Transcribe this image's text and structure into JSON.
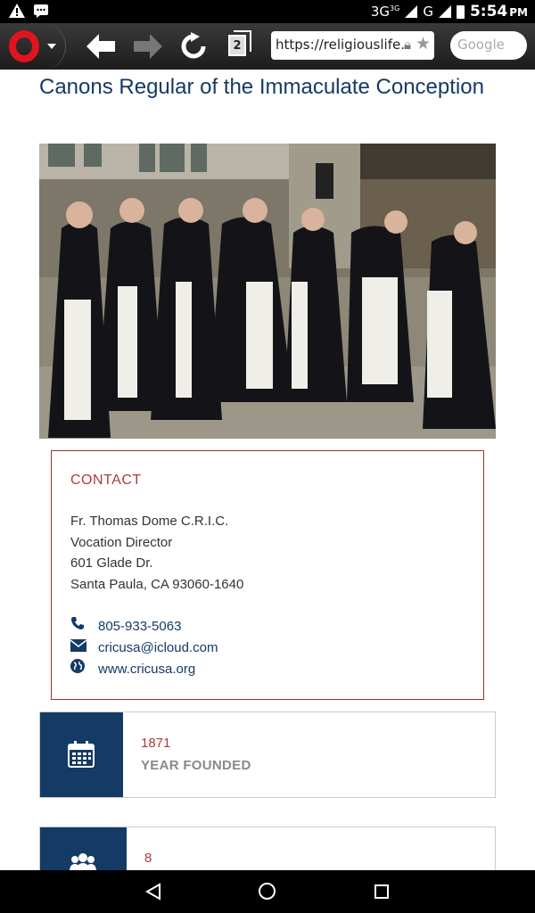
{
  "status": {
    "network": "3G",
    "network_sup": "3G",
    "network2": "G",
    "time": "5:54",
    "ampm": "PM"
  },
  "browser": {
    "url": "https://religiouslife.",
    "search_placeholder": "Google",
    "tab_count": "2"
  },
  "page": {
    "title": "Canons Regular of the Immaculate Conception",
    "contact": {
      "heading": "CONTACT",
      "name": "Fr.  Thomas Dome C.R.I.C.",
      "role": "Vocation Director",
      "street": "601 Glade Dr.",
      "city": "Santa Paula, CA 93060-1640",
      "phone": "805-933-5063",
      "email": "cricusa@icloud.com",
      "website": "www.cricusa.org"
    },
    "stats": [
      {
        "value": "1871",
        "label": "YEAR FOUNDED",
        "icon": "calendar-icon"
      },
      {
        "value": "8",
        "label": "",
        "icon": "group-icon"
      }
    ]
  },
  "colors": {
    "primary": "#143a66",
    "accent": "#b23a3a"
  }
}
